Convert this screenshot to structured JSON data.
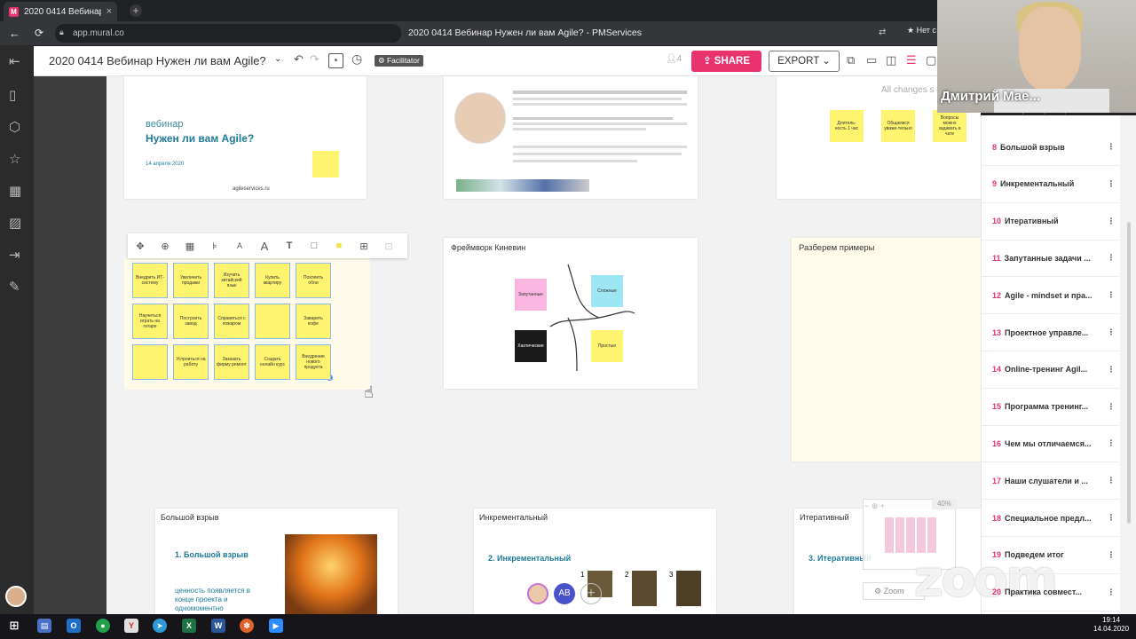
{
  "browser": {
    "tab_title": "2020 0414 Вебинар Ну",
    "favicon": "M",
    "close": "×",
    "new_tab": "+",
    "url": "app.mural.co",
    "page_title": "2020 0414 Вебинар Нужен ли вам Agile? - PMServices",
    "sync_status": "Нет с"
  },
  "toolbar": {
    "board_title": "2020 0414 Вебинар Нужен ли вам Agile?",
    "facilitator": "Facilitator",
    "user_count": "4",
    "share": "SHARE",
    "export": "EXPORT"
  },
  "canvas": {
    "all_changes": "All changes s",
    "title_card": {
      "kicker": "вебинар",
      "title": "Нужен ли вам Agile?",
      "date": "14 апреля 2020",
      "site": "agileservices.ru"
    },
    "top_stickies": [
      "Длитель-ность 1 час",
      "Общаемся уважи-тельно",
      "Вопросы можно задавать в чате"
    ],
    "grid_stickies": [
      "Внедрить ИТ-систему",
      "Увеличить продажи",
      "Изучить китайский язык",
      "Купить квартиру",
      "Похлеить обои",
      "Научиться играть на гитаре",
      "Построить завод",
      "Справиться с пожаром",
      "",
      "Заварить кофе",
      "",
      "Устроиться на работу",
      "Заказать фирму ремонт",
      "Создать онлайн курс",
      "Внедрение нового продукта"
    ],
    "cynefin": {
      "title": "Фреймворк Киневин",
      "complex": "Запутанные",
      "complicated": "Сложные",
      "chaotic": "Хаотические",
      "simple": "Простые"
    },
    "examples_title": "Разберем примеры",
    "bigbang": {
      "header": "Большой взрыв",
      "heading": "1. Большой взрыв",
      "body": "ценность появляется в конце проекта и одномоментно"
    },
    "incremental": {
      "header": "Инкрементальный",
      "heading": "2. Инкрементальный",
      "steps": [
        "1",
        "2",
        "3"
      ],
      "avatar": "AB"
    },
    "iterative": {
      "header": "Итеративный",
      "heading": "3. Итеративный"
    },
    "zoom_label": "Zoom",
    "zoom_pct": "40%"
  },
  "outline": [
    {
      "num": "8",
      "label": "Большой взрыв"
    },
    {
      "num": "9",
      "label": "Инкрементальный"
    },
    {
      "num": "10",
      "label": "Итеративный"
    },
    {
      "num": "11",
      "label": "Запутанные задачи ..."
    },
    {
      "num": "12",
      "label": "Agile - mindset и пра..."
    },
    {
      "num": "13",
      "label": "Проектное управле..."
    },
    {
      "num": "14",
      "label": "Online-тренинг Agil..."
    },
    {
      "num": "15",
      "label": "Программа тренинг..."
    },
    {
      "num": "16",
      "label": "Чем мы отличаемся..."
    },
    {
      "num": "17",
      "label": "Наши слушатели и ..."
    },
    {
      "num": "18",
      "label": "Специальное предл..."
    },
    {
      "num": "19",
      "label": "Подведем итог"
    },
    {
      "num": "20",
      "label": "Практика совмест..."
    }
  ],
  "outline_top_partial": "7 Разберем примеры",
  "video": {
    "name": "Дмитрий Мае..."
  },
  "zoom_watermark": "zoom",
  "clock": {
    "time": "19:14",
    "date": "14.04.2020"
  },
  "colors": {
    "accent": "#e8336e",
    "sticky": "#fff46f",
    "pink": "#f8b6e0",
    "cyan": "#9fe6f5"
  }
}
